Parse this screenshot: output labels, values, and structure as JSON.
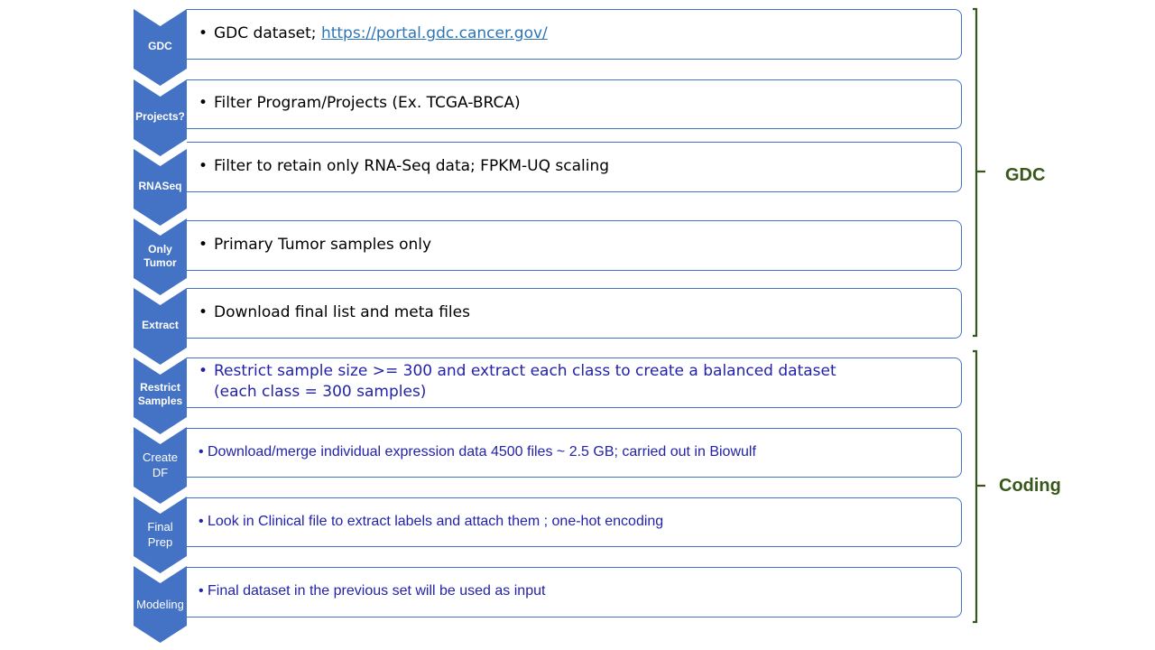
{
  "steps": [
    {
      "label": "GDC",
      "text": "GDC dataset; ",
      "link": "https://portal.gdc.cancer.gov/"
    },
    {
      "label": "Projects?",
      "text": "Filter Program/Projects (Ex. TCGA-BRCA)"
    },
    {
      "label": "RNASeq",
      "text": "Filter to retain only RNA-Seq data; FPKM-UQ scaling"
    },
    {
      "label_line1": "Only",
      "label_line2": "Tumor",
      "text": "Primary Tumor samples only"
    },
    {
      "label": "Extract",
      "text": "Download final list and meta files"
    },
    {
      "label_line1": "Restrict",
      "label_line2": "Samples",
      "text_line1": "Restrict sample size >= 300 and extract each class to create a balanced dataset",
      "text_line2": "(each class = 300 samples)"
    },
    {
      "label_line1": "Create",
      "label_line2": "DF",
      "text": "Download/merge individual expression data 4500 files ~ 2.5 GB; carried out in Biowulf"
    },
    {
      "label_line1": "Final",
      "label_line2": "Prep",
      "text": "Look in Clinical file to extract labels and attach them ; one-hot encoding"
    },
    {
      "label": "Modeling",
      "text": "Final dataset in the previous set will be used as input"
    }
  ],
  "groups": {
    "gdc": "GDC",
    "coding": "Coding"
  },
  "colors": {
    "chevron": "#4472c4",
    "group_label": "#38571a",
    "coding_text": "#2222aa",
    "link": "#2e75b6"
  }
}
